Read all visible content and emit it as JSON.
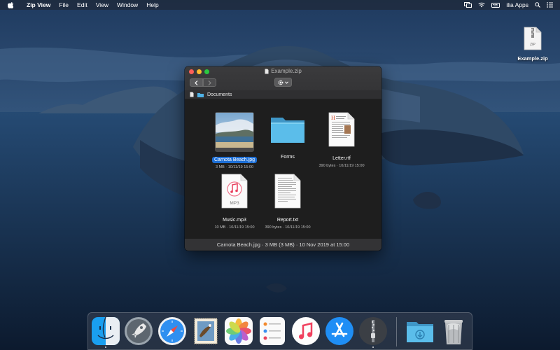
{
  "menubar": {
    "app_name": "Zip View",
    "menus": [
      "File",
      "Edit",
      "View",
      "Window",
      "Help"
    ],
    "status_user": "ilia Apps"
  },
  "desktop": {
    "file_label": "Example.zip",
    "file_badge": "ZIP"
  },
  "window": {
    "title": "Example.zip",
    "path": "Documents",
    "items": [
      {
        "name": "Carnota Beach.jpg",
        "meta": "3 MB · 10/11/19 15:00",
        "selected": true,
        "kind": "image"
      },
      {
        "name": "Forms",
        "meta": "",
        "selected": false,
        "kind": "folder"
      },
      {
        "name": "Letter.rtf",
        "meta": "390 bytes · 10/11/19 15:00",
        "selected": false,
        "kind": "document"
      },
      {
        "name": "Music.mp3",
        "meta": "10 MB · 10/11/19 15:00",
        "selected": false,
        "kind": "audio"
      },
      {
        "name": "Report.txt",
        "meta": "390 bytes · 10/11/19 15:00",
        "selected": false,
        "kind": "text"
      }
    ],
    "mp3_badge": "MP3",
    "status": "Carnota Beach.jpg · 3 MB (3 MB) · 10 Nov 2019 at 15:00"
  },
  "dock": {
    "apps": [
      "finder-icon",
      "launchpad-icon",
      "safari-icon",
      "mail-icon",
      "photos-icon",
      "reminders-icon",
      "music-icon",
      "app-store-icon",
      "zip-view-icon",
      "downloads-folder-icon",
      "trash-icon"
    ]
  },
  "colors": {
    "selection": "#1d6fd6",
    "close": "#fd5f57",
    "minimize": "#febb2e",
    "maximize": "#2ac840"
  }
}
